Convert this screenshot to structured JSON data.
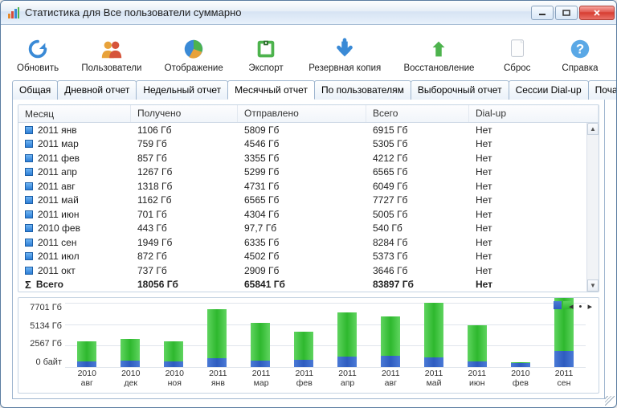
{
  "window": {
    "title": "Статистика для Все пользователи суммарно"
  },
  "toolbar": {
    "refresh": "Обновить",
    "users": "Пользователи",
    "display": "Отображение",
    "export": "Экспорт",
    "backup": "Резервная копия",
    "restore": "Восстановление",
    "reset": "Сброс",
    "help": "Справка"
  },
  "tabs": {
    "general": "Общая",
    "daily": "Дневной отчет",
    "weekly": "Недельный отчет",
    "monthly": "Месячный отчет",
    "by_users": "По пользователям",
    "selective": "Выборочный отчет",
    "dialup_sessions": "Сессии Dial-up",
    "hourly": "Почасовой отчет"
  },
  "table": {
    "columns": {
      "month": "Месяц",
      "received": "Получено",
      "sent": "Отправлено",
      "total": "Всего",
      "dialup": "Dial-up"
    },
    "rows": [
      {
        "month": "2011 янв",
        "received": "1106 Гб",
        "sent": "5809 Гб",
        "total": "6915 Гб",
        "dialup": "Нет"
      },
      {
        "month": "2011 мар",
        "received": "759 Гб",
        "sent": "4546 Гб",
        "total": "5305 Гб",
        "dialup": "Нет"
      },
      {
        "month": "2011 фев",
        "received": "857 Гб",
        "sent": "3355 Гб",
        "total": "4212 Гб",
        "dialup": "Нет"
      },
      {
        "month": "2011 апр",
        "received": "1267 Гб",
        "sent": "5299 Гб",
        "total": "6565 Гб",
        "dialup": "Нет"
      },
      {
        "month": "2011 авг",
        "received": "1318 Гб",
        "sent": "4731 Гб",
        "total": "6049 Гб",
        "dialup": "Нет"
      },
      {
        "month": "2011 май",
        "received": "1162 Гб",
        "sent": "6565 Гб",
        "total": "7727 Гб",
        "dialup": "Нет"
      },
      {
        "month": "2011 июн",
        "received": "701 Гб",
        "sent": "4304 Гб",
        "total": "5005 Гб",
        "dialup": "Нет"
      },
      {
        "month": "2010 фев",
        "received": "443 Гб",
        "sent": "97,7 Гб",
        "total": "540 Гб",
        "dialup": "Нет"
      },
      {
        "month": "2011 сен",
        "received": "1949 Гб",
        "sent": "6335 Гб",
        "total": "8284 Гб",
        "dialup": "Нет"
      },
      {
        "month": "2011 июл",
        "received": "872 Гб",
        "sent": "4502 Гб",
        "total": "5373 Гб",
        "dialup": "Нет"
      },
      {
        "month": "2011 окт",
        "received": "737 Гб",
        "sent": "2909 Гб",
        "total": "3646 Гб",
        "dialup": "Нет"
      }
    ],
    "total": {
      "label": "Всего",
      "received": "18056 Гб",
      "sent": "65841 Гб",
      "total": "83897 Гб",
      "dialup": "Нет"
    }
  },
  "colors": {
    "series_received": "#2e5cc0",
    "series_sent": "#2eb82e"
  },
  "chart_data": {
    "type": "bar",
    "ylabel": "",
    "ylim": [
      0,
      7701
    ],
    "y_ticks": [
      "7701 Гб",
      "5134 Гб",
      "2567 Гб",
      "0 байт"
    ],
    "categories": [
      "2010\nавг",
      "2010\nдек",
      "2010\nноя",
      "2011\nянв",
      "2011\nмар",
      "2011\nфев",
      "2011\nапр",
      "2011\nавг",
      "2011\nмай",
      "2011\nиюн",
      "2010\nфев",
      "2011\nсен"
    ],
    "series": [
      {
        "name": "Получено",
        "color": "#2e5cc0",
        "values": [
          700,
          800,
          700,
          1106,
          759,
          857,
          1267,
          1318,
          1162,
          701,
          443,
          1949
        ]
      },
      {
        "name": "Отправлено",
        "color": "#2eb82e",
        "values": [
          2400,
          2600,
          2400,
          5809,
          4546,
          3355,
          5299,
          4731,
          6565,
          4304,
          98,
          6335
        ]
      }
    ]
  }
}
